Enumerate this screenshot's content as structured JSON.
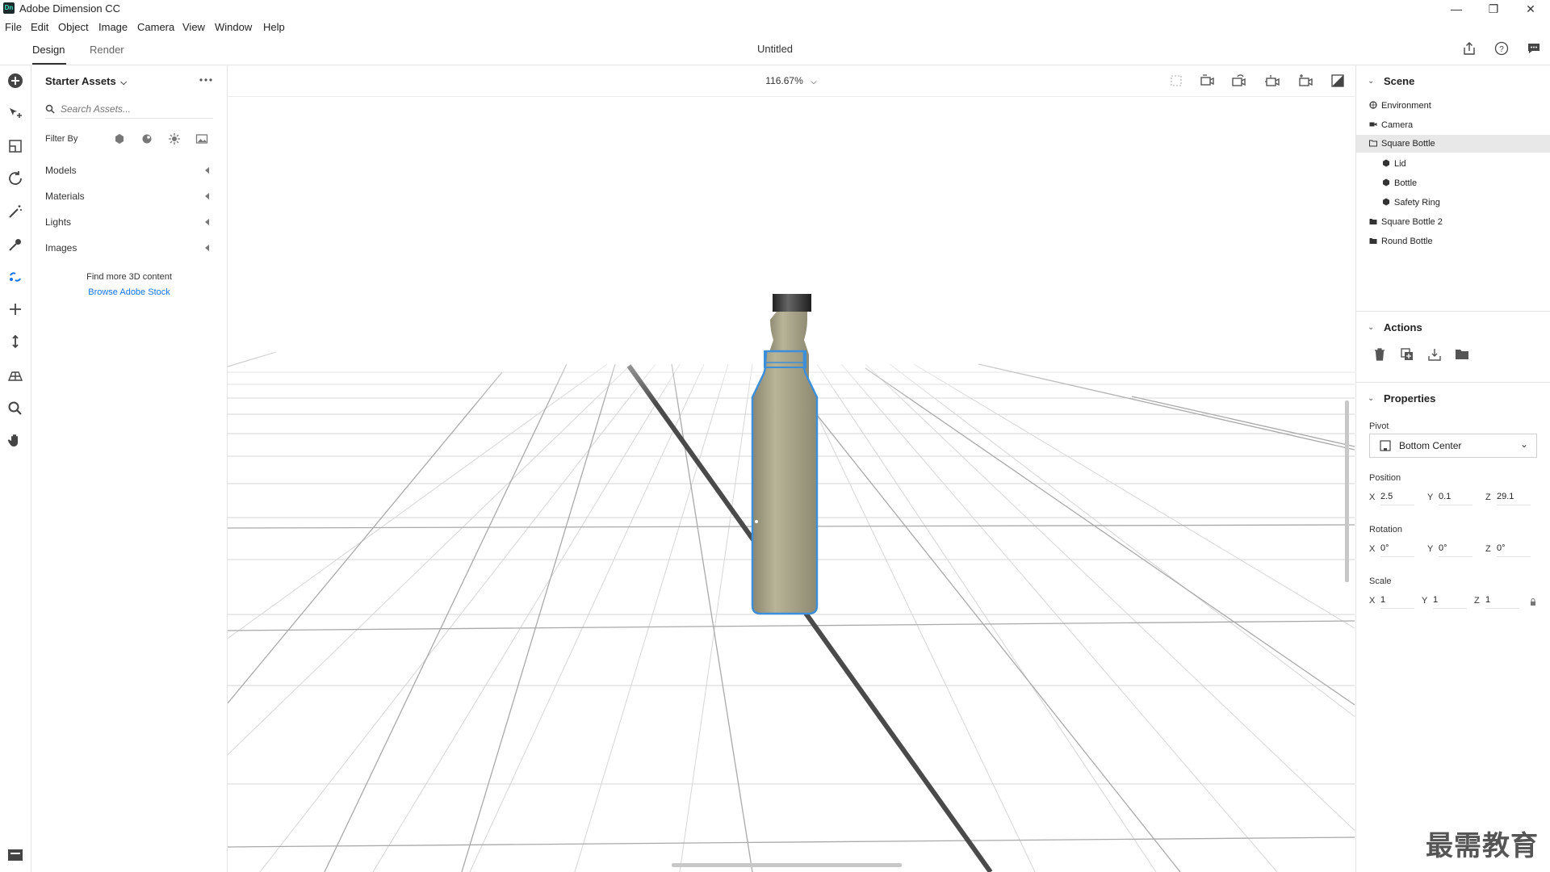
{
  "app": {
    "logo": "Dn",
    "title": "Adobe Dimension CC"
  },
  "window": {
    "minimize": "—",
    "restore": "❐",
    "close": "✕"
  },
  "menu": [
    "File",
    "Edit",
    "Object",
    "Image",
    "Camera",
    "View",
    "Window",
    "Help"
  ],
  "tabs": [
    {
      "label": "Design",
      "active": true
    },
    {
      "label": "Render",
      "active": false
    }
  ],
  "document": {
    "title": "Untitled"
  },
  "top_icons": [
    "share-icon",
    "help-icon",
    "feedback-icon"
  ],
  "toolbar": {
    "tools": [
      "add-icon",
      "select-icon",
      "marquee-icon",
      "orbit-icon",
      "magic-wand-icon",
      "sampler-icon",
      "link-icon",
      "pan-icon",
      "dolly-icon",
      "horizon-icon",
      "zoom-icon",
      "hand-icon"
    ]
  },
  "assets": {
    "title": "Starter Assets",
    "search_placeholder": "Search Assets...",
    "filter_label": "Filter By",
    "filter_icons": [
      "model-filter-icon",
      "material-filter-icon",
      "light-filter-icon",
      "image-filter-icon"
    ],
    "categories": [
      "Models",
      "Materials",
      "Lights",
      "Images"
    ],
    "find_more": "Find more 3D content",
    "browse_link": "Browse Adobe Stock"
  },
  "viewport": {
    "zoom": "116.67%",
    "toolbar_icons": [
      "frame-icon",
      "camera-orbit-icon",
      "camera-pan-icon",
      "camera-dolly-icon",
      "camera-bookmark-icon",
      "render-preview-icon"
    ]
  },
  "scene": {
    "title": "Scene",
    "items": [
      "Environment",
      "Camera",
      "Square Bottle",
      "Lid",
      "Bottle",
      "Safety Ring",
      "Square Bottle 2",
      "Round Bottle"
    ],
    "selected": "Square Bottle"
  },
  "actions": {
    "title": "Actions",
    "icons": [
      "delete-icon",
      "duplicate-icon",
      "export-icon",
      "group-icon"
    ]
  },
  "properties": {
    "title": "Properties",
    "pivot_label": "Pivot",
    "pivot_value": "Bottom Center",
    "position_label": "Position",
    "position": {
      "x": "2.5",
      "y": "0.1",
      "z": "29.1"
    },
    "rotation_label": "Rotation",
    "rotation": {
      "x": "0°",
      "y": "0°",
      "z": "0°"
    },
    "scale_label": "Scale",
    "scale": {
      "x": "1",
      "y": "1",
      "z": "1"
    }
  },
  "watermark": "最需教育",
  "colors": {
    "accent": "#1473e6",
    "selection": "#3d8fd9",
    "bottle": "#a7a387"
  }
}
